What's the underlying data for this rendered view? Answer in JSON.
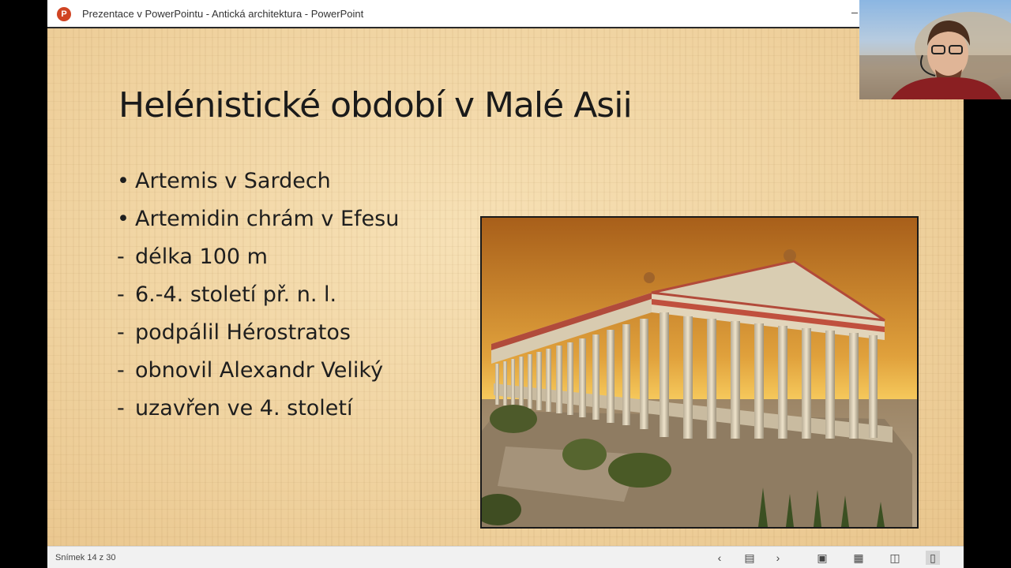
{
  "window": {
    "title": "Prezentace v PowerPointu  -  Antická architektura - PowerPoint",
    "app_icon": "powerpoint-icon",
    "app_icon_letter": "P"
  },
  "slide": {
    "title": "Helénistické období v Malé Asii",
    "items": [
      {
        "marker": "•",
        "text": "Artemis v Sardech"
      },
      {
        "marker": "•",
        "text": "Artemidin chrám v Efesu"
      },
      {
        "marker": "-",
        "text": "délka 100 m"
      },
      {
        "marker": "-",
        "text": "6.-4. století př. n. l."
      },
      {
        "marker": "-",
        "text": "podpálil Hérostratos"
      },
      {
        "marker": "-",
        "text": "obnovil Alexandr Veliký"
      },
      {
        "marker": "-",
        "text": "uzavřen ve 4. století"
      }
    ],
    "image": "temple-of-artemis-rendering"
  },
  "statusbar": {
    "slide_counter": "Snímek 14 z 30",
    "icons": [
      "prev-slide-icon",
      "slide-menu-icon",
      "next-slide-icon",
      "normal-view-icon",
      "slide-sorter-icon",
      "reading-view-icon",
      "slide-show-icon"
    ]
  },
  "webcam": {
    "content": "presenter-video"
  },
  "colors": {
    "slide_bg": "#f0d3a0",
    "title_text": "#1a1a1a",
    "powerpoint_brand": "#d04423"
  }
}
